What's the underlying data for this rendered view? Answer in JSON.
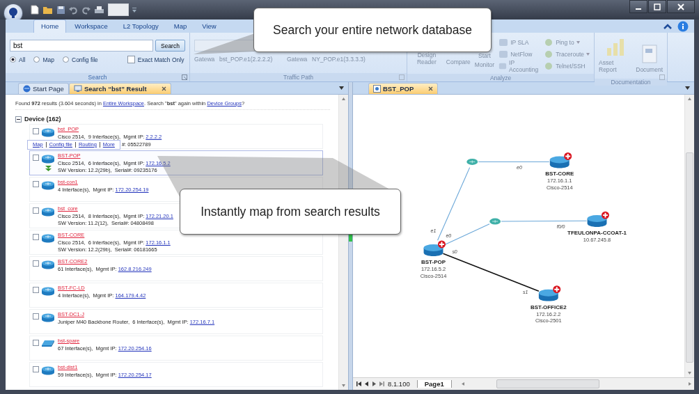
{
  "ribbon": {
    "tabs": [
      {
        "label": "Home",
        "selected": true
      },
      {
        "label": "Workspace",
        "selected": false
      },
      {
        "label": "L2 Topology",
        "selected": false
      },
      {
        "label": "Map",
        "selected": false
      },
      {
        "label": "View",
        "selected": false
      }
    ],
    "search": {
      "query": "bst",
      "button": "Search",
      "scopes": [
        {
          "label": "All",
          "selected": true
        },
        {
          "label": "Map",
          "selected": false
        },
        {
          "label": "Config file",
          "selected": false
        }
      ],
      "exact_match": {
        "label": "Exact Match Only",
        "checked": false
      },
      "label": "Search"
    },
    "traffic_path": {
      "disabled": true,
      "fields": [
        {
          "label": "Gatewa",
          "value": "bst_POP.e1(2.2.2.2)"
        },
        {
          "label": "Gatewa",
          "value": "NY_POP.e1(3.3.3.3)"
        }
      ],
      "label": "Traffic Path"
    },
    "analyze": {
      "disabled": true,
      "large": [
        "Design Reader",
        "Compare",
        "Start Monitor"
      ],
      "small": [
        {
          "label": "IP SLA",
          "dropdown": false
        },
        {
          "label": "NetFlow",
          "dropdown": false
        },
        {
          "label": "IP Accounting",
          "dropdown": false
        },
        {
          "label": "Ping to",
          "dropdown": true
        },
        {
          "label": "Traceroute",
          "dropdown": true
        },
        {
          "label": "Telnet/SSH",
          "dropdown": false
        }
      ],
      "label": "Analyze"
    },
    "documentation": {
      "disabled": true,
      "buttons": [
        "Asset Report",
        "Document"
      ],
      "label": "Documentation"
    }
  },
  "left_tabs": [
    {
      "label": "Start Page",
      "selected": false
    },
    {
      "label": "Search “bst” Result",
      "selected": true
    }
  ],
  "results": {
    "summary": {
      "prefix": "Found **972** results (3.604 seconds) in ",
      "link": "Entire Workspace",
      "middle": ". Search \"**bst**\" again within ",
      "link2": "Device Groups",
      "suffix": "?"
    },
    "group": {
      "label": "Device (162)",
      "expanded": true
    },
    "items": [
      {
        "kind": "router",
        "name": "bst_POP",
        "details": "Cisco 2514,  9 Interface(s),  Mgmt IP: ",
        "ip": "2.2.2.2",
        "version": "#: 05522789",
        "checked": false,
        "selected": false,
        "actions": [
          "Map",
          "Config file",
          "Routing",
          "More"
        ]
      },
      {
        "kind": "router",
        "name": "BST-POP",
        "details": "Cisco 2514,  6 Interface(s),  Mgmt IP: ",
        "ip": "172.16.5.2",
        "version": "SW Version: 12.2(29b),  Serial#: 09235176",
        "checked": false,
        "selected": true
      },
      {
        "kind": "router",
        "name": "bst-con1",
        "details": "4 Interface(s),  Mgmt IP: ",
        "ip": "172.20.254.19",
        "checked": false,
        "selected": false
      },
      {
        "kind": "router",
        "name": "bst_core",
        "details": "Cisco 2514,  8 Interface(s),  Mgmt IP: ",
        "ip": "172.21.20.1",
        "version": "SW Version: 11.2(12),  Serial#: 04808498",
        "checked": false,
        "selected": false
      },
      {
        "kind": "router",
        "name": "BST-CORE",
        "details": "Cisco 2514,  6 Interface(s),  Mgmt IP: ",
        "ip": "172.16.1.1",
        "version": "SW Version: 12.2(29b),  Serial#: 06181665",
        "checked": false,
        "selected": false
      },
      {
        "kind": "router",
        "name": "BST-CORE2",
        "details": "61 Interface(s),  Mgmt IP: ",
        "ip": "162.8.216.249",
        "checked": false,
        "selected": false
      },
      {
        "kind": "router",
        "name": "BST-FC-LD",
        "details": "4 Interface(s),  Mgmt IP: ",
        "ip": "164.179.4.42",
        "checked": false,
        "selected": false
      },
      {
        "kind": "router",
        "name": "BST-DC1-J",
        "details": "Juniper M40 Backbone Router,  6 Interface(s),  Mgmt IP: ",
        "ip": "172.16.7.1",
        "checked": false,
        "selected": false
      },
      {
        "kind": "switch",
        "name": "bst-spare",
        "details": "67 Interface(s),  Mgmt IP: ",
        "ip": "172.20.254.16",
        "checked": false,
        "selected": false
      },
      {
        "kind": "router",
        "name": "bst-dist1",
        "details": "59 Interface(s),  Mgmt IP: ",
        "ip": "172.20.254.17",
        "checked": false,
        "selected": false
      }
    ]
  },
  "right_tabs": [
    {
      "label": "BST_POP",
      "selected": true
    }
  ],
  "map": {
    "nodes": [
      {
        "name": "BST-CORE",
        "ip": "172.16.1.1",
        "model": "Cisco-2514"
      },
      {
        "name": "TFEULONPA-CCOAT-1",
        "ip": "10.67.245.8"
      },
      {
        "name": "BST-POP",
        "ip": "172.16.5.2",
        "model": "Cisco-2514"
      },
      {
        "name": "BST-OFFICE2",
        "ip": "172.16.2.2",
        "model": "Cisco-2501"
      }
    ],
    "links": [
      {
        "kind": "ethernet",
        "labels": [
          "e1"
        ]
      },
      {
        "kind": "ethernet",
        "labels": [
          "e0"
        ]
      },
      {
        "kind": "ethernet",
        "labels": [
          "e0"
        ]
      },
      {
        "kind": "ethernet",
        "labels": [
          "f0/0"
        ]
      },
      {
        "kind": "serial",
        "labels": [
          "s0",
          "s1"
        ]
      }
    ],
    "sheets": [
      {
        "label": "8.1.100",
        "selected": false
      },
      {
        "label": "Page1",
        "selected": true
      }
    ]
  },
  "callouts": [
    {
      "text": "Search your entire network database"
    },
    {
      "text": "Instantly map from search results"
    }
  ]
}
